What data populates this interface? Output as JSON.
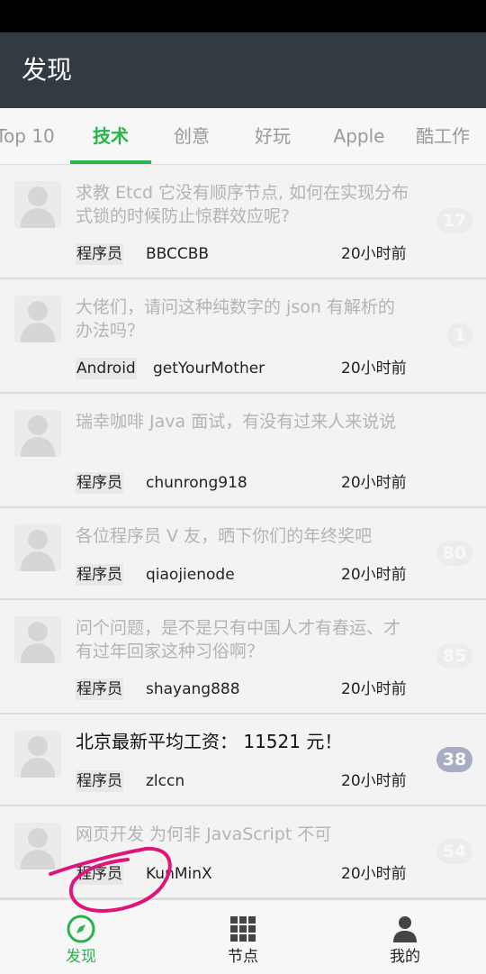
{
  "app": {
    "title": "发现"
  },
  "tabs": [
    {
      "label": "Top 10"
    },
    {
      "label": "技术"
    },
    {
      "label": "创意"
    },
    {
      "label": "好玩"
    },
    {
      "label": "Apple"
    },
    {
      "label": "酷工作"
    }
  ],
  "topics": [
    {
      "title": "求教 Etcd 它没有顺序节点, 如何在实现分布式锁的时候防止惊群效应呢?",
      "node": "程序员",
      "user": "BBCCBB",
      "time": "20小时前",
      "replies": "17",
      "unread": false
    },
    {
      "title": "大佬们，请问这种纯数字的 json 有解析的办法吗？",
      "node": "Android",
      "user": "getYourMother",
      "time": "20小时前",
      "replies": "1",
      "unread": false
    },
    {
      "title": "瑞幸咖啡 Java 面试，有没有过来人来说说",
      "node": "程序员",
      "user": "chunrong918",
      "time": "20小时前",
      "replies": "",
      "unread": false
    },
    {
      "title": "各位程序员 V 友，晒下你们的年终奖吧",
      "node": "程序员",
      "user": "qiaojienode",
      "time": "20小时前",
      "replies": "80",
      "unread": false
    },
    {
      "title": "问个问题，是不是只有中国人才有春运、才有过年回家这种习俗啊？",
      "node": "程序员",
      "user": "shayang888",
      "time": "20小时前",
      "replies": "85",
      "unread": false
    },
    {
      "title": "北京最新平均工资： 11521 元！",
      "node": "程序员",
      "user": "zlccn",
      "time": "20小时前",
      "replies": "38",
      "unread": true
    },
    {
      "title": "网页开发 为何非 JavaScript 不可",
      "node": "程序员",
      "user": "KunMinX",
      "time": "20小时前",
      "replies": "54",
      "unread": false
    }
  ],
  "bottom_nav": [
    {
      "label": "发现",
      "icon": "compass-icon"
    },
    {
      "label": "节点",
      "icon": "grid-icon"
    },
    {
      "label": "我的",
      "icon": "person-icon"
    }
  ],
  "colors": {
    "accent": "#2bb24c",
    "app_bar": "#323a42",
    "unread_badge": "#a6adc4",
    "annotation": "#e0157a"
  }
}
